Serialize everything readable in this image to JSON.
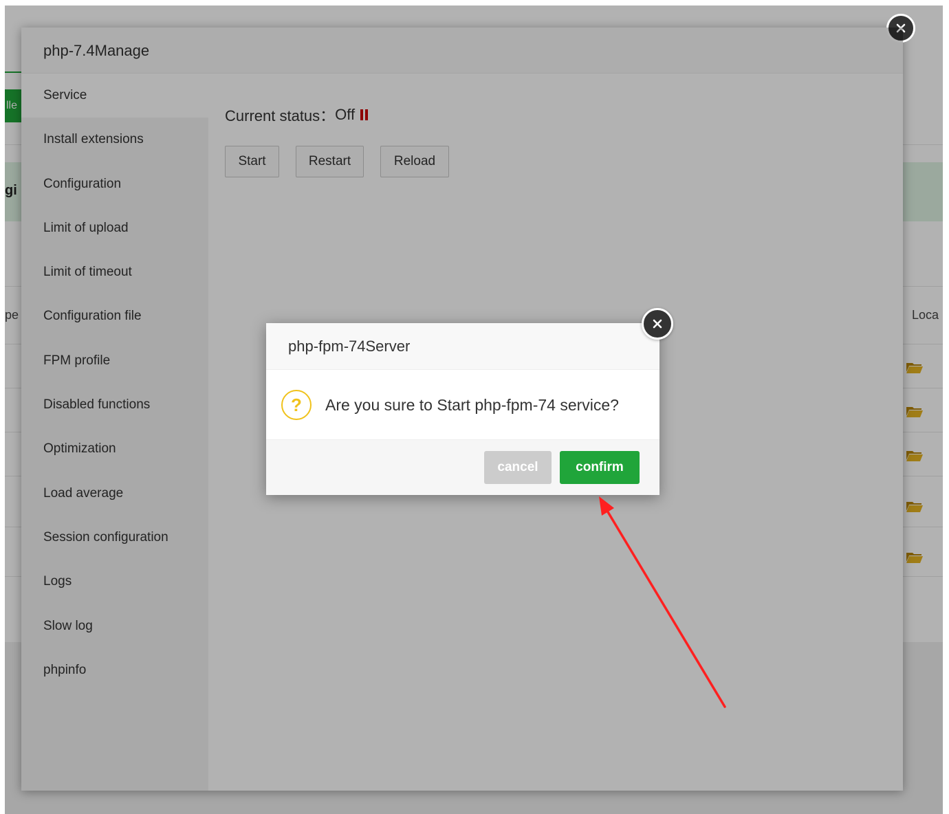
{
  "background": {
    "button_fragment": "lle",
    "banner_fragment": "gi",
    "table_header_left": "pe",
    "table_header_right": "Loca"
  },
  "manage_modal": {
    "title": "php-7.4Manage",
    "sidebar": [
      {
        "label": "Service",
        "active": true
      },
      {
        "label": "Install extensions"
      },
      {
        "label": "Configuration"
      },
      {
        "label": "Limit of upload"
      },
      {
        "label": "Limit of timeout"
      },
      {
        "label": "Configuration file"
      },
      {
        "label": "FPM profile"
      },
      {
        "label": "Disabled functions"
      },
      {
        "label": "Optimization"
      },
      {
        "label": "Load average"
      },
      {
        "label": "Session configuration"
      },
      {
        "label": "Logs"
      },
      {
        "label": "Slow log"
      },
      {
        "label": "phpinfo"
      }
    ],
    "status_label": "Current status：",
    "status_value": "Off",
    "buttons": {
      "start": "Start",
      "restart": "Restart",
      "reload": "Reload"
    }
  },
  "confirm_dialog": {
    "title": "php-fpm-74Server",
    "message": "Are you sure to Start php-fpm-74 service?",
    "question_mark": "?",
    "cancel_label": "cancel",
    "confirm_label": "confirm"
  },
  "colors": {
    "accent_green": "#20a53a",
    "status_off_red": "#cc0000",
    "question_yellow": "#f0c21b",
    "annotation_arrow": "#ff2020"
  }
}
